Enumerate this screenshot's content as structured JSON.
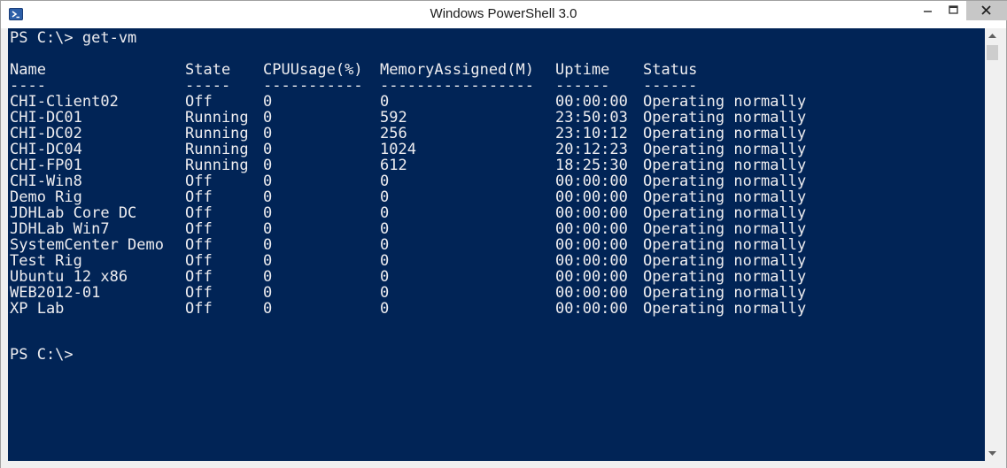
{
  "window": {
    "title": "Windows PowerShell 3.0"
  },
  "console": {
    "command_line": "PS C:\\> get-vm",
    "columns": {
      "name": "Name",
      "state": "State",
      "cpu": "CPUUsage(%)",
      "memory": "MemoryAssigned(M)",
      "uptime": "Uptime",
      "status": "Status"
    },
    "underlines": {
      "name": "----",
      "state": "-----",
      "cpu": "-----------",
      "memory": "-----------------",
      "uptime": "------",
      "status": "------"
    },
    "rows": [
      {
        "name": "CHI-Client02",
        "state": "Off",
        "cpu": "0",
        "memory": "0",
        "uptime": "00:00:00",
        "status": "Operating normally"
      },
      {
        "name": "CHI-DC01",
        "state": "Running",
        "cpu": "0",
        "memory": "592",
        "uptime": "23:50:03",
        "status": "Operating normally"
      },
      {
        "name": "CHI-DC02",
        "state": "Running",
        "cpu": "0",
        "memory": "256",
        "uptime": "23:10:12",
        "status": "Operating normally"
      },
      {
        "name": "CHI-DC04",
        "state": "Running",
        "cpu": "0",
        "memory": "1024",
        "uptime": "20:12:23",
        "status": "Operating normally"
      },
      {
        "name": "CHI-FP01",
        "state": "Running",
        "cpu": "0",
        "memory": "612",
        "uptime": "18:25:30",
        "status": "Operating normally"
      },
      {
        "name": "CHI-Win8",
        "state": "Off",
        "cpu": "0",
        "memory": "0",
        "uptime": "00:00:00",
        "status": "Operating normally"
      },
      {
        "name": "Demo Rig",
        "state": "Off",
        "cpu": "0",
        "memory": "0",
        "uptime": "00:00:00",
        "status": "Operating normally"
      },
      {
        "name": "JDHLab Core DC",
        "state": "Off",
        "cpu": "0",
        "memory": "0",
        "uptime": "00:00:00",
        "status": "Operating normally"
      },
      {
        "name": "JDHLab Win7",
        "state": "Off",
        "cpu": "0",
        "memory": "0",
        "uptime": "00:00:00",
        "status": "Operating normally"
      },
      {
        "name": "SystemCenter Demo",
        "state": "Off",
        "cpu": "0",
        "memory": "0",
        "uptime": "00:00:00",
        "status": "Operating normally"
      },
      {
        "name": "Test Rig",
        "state": "Off",
        "cpu": "0",
        "memory": "0",
        "uptime": "00:00:00",
        "status": "Operating normally"
      },
      {
        "name": "Ubuntu 12 x86",
        "state": "Off",
        "cpu": "0",
        "memory": "0",
        "uptime": "00:00:00",
        "status": "Operating normally"
      },
      {
        "name": "WEB2012-01",
        "state": "Off",
        "cpu": "0",
        "memory": "0",
        "uptime": "00:00:00",
        "status": "Operating normally"
      },
      {
        "name": "XP Lab",
        "state": "Off",
        "cpu": "0",
        "memory": "0",
        "uptime": "00:00:00",
        "status": "Operating normally"
      }
    ],
    "prompt": "PS C:\\>"
  },
  "colors": {
    "console_background": "#012456",
    "console_text": "#eeedf0"
  },
  "icons": {
    "app": "powershell-icon",
    "minimize": "minimize-icon",
    "maximize": "maximize-icon",
    "close": "close-icon",
    "scroll_up": "scroll-up-arrow-icon",
    "scroll_down": "scroll-down-arrow-icon"
  }
}
